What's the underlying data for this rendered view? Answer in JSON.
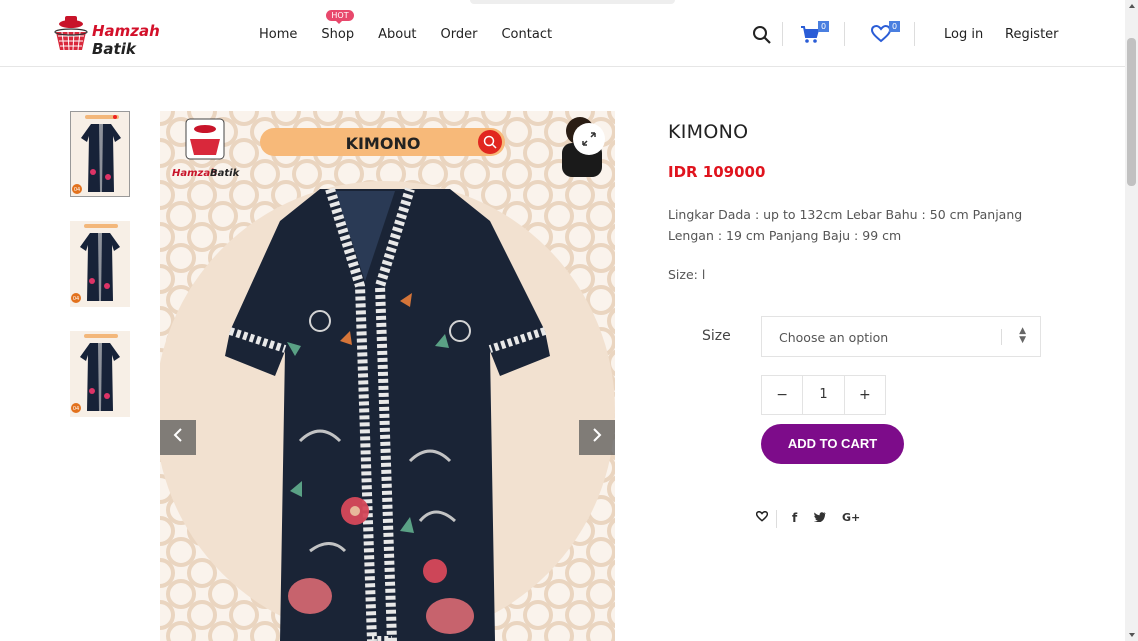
{
  "brand": {
    "name_part1": "Hamzah",
    "name_part2": "Batik"
  },
  "nav": {
    "items": [
      {
        "label": "Home"
      },
      {
        "label": "Shop",
        "badge": "HOT"
      },
      {
        "label": "About"
      },
      {
        "label": "Order"
      },
      {
        "label": "Contact"
      }
    ]
  },
  "header": {
    "cart_count": "0",
    "wishlist_count": "0",
    "login_label": "Log in",
    "register_label": "Register",
    "icons": [
      "search-icon",
      "cart-icon",
      "heart-icon"
    ]
  },
  "gallery": {
    "thumbnails": [
      {
        "badge": "04"
      },
      {
        "badge": "04"
      },
      {
        "badge": "04"
      }
    ],
    "image": {
      "banner_text": "KIMONO",
      "logo_text_1": "Hamzah",
      "logo_text_2": "Batik"
    }
  },
  "product": {
    "title": "KIMONO",
    "price": "IDR 109000",
    "description": "Lingkar Dada : up to 132cm Lebar Bahu : 50 cm Panjang Lengan : 19 cm Panjang Baju : 99 cm",
    "size_line": "Size: l",
    "size_label": "Size",
    "size_select_value": "Choose an option",
    "quantity": "1",
    "minus_label": "−",
    "plus_label": "+",
    "add_to_cart_label": "ADD TO CART"
  },
  "share": {
    "icons": [
      "wishlist-heart-icon",
      "facebook-icon",
      "twitter-icon",
      "google-plus-icon"
    ]
  },
  "colors": {
    "accent_purple": "#7d0c8a",
    "price_red": "#e0141e",
    "badge_blue": "#4a7fe0",
    "hot_pink": "#e8486c"
  }
}
